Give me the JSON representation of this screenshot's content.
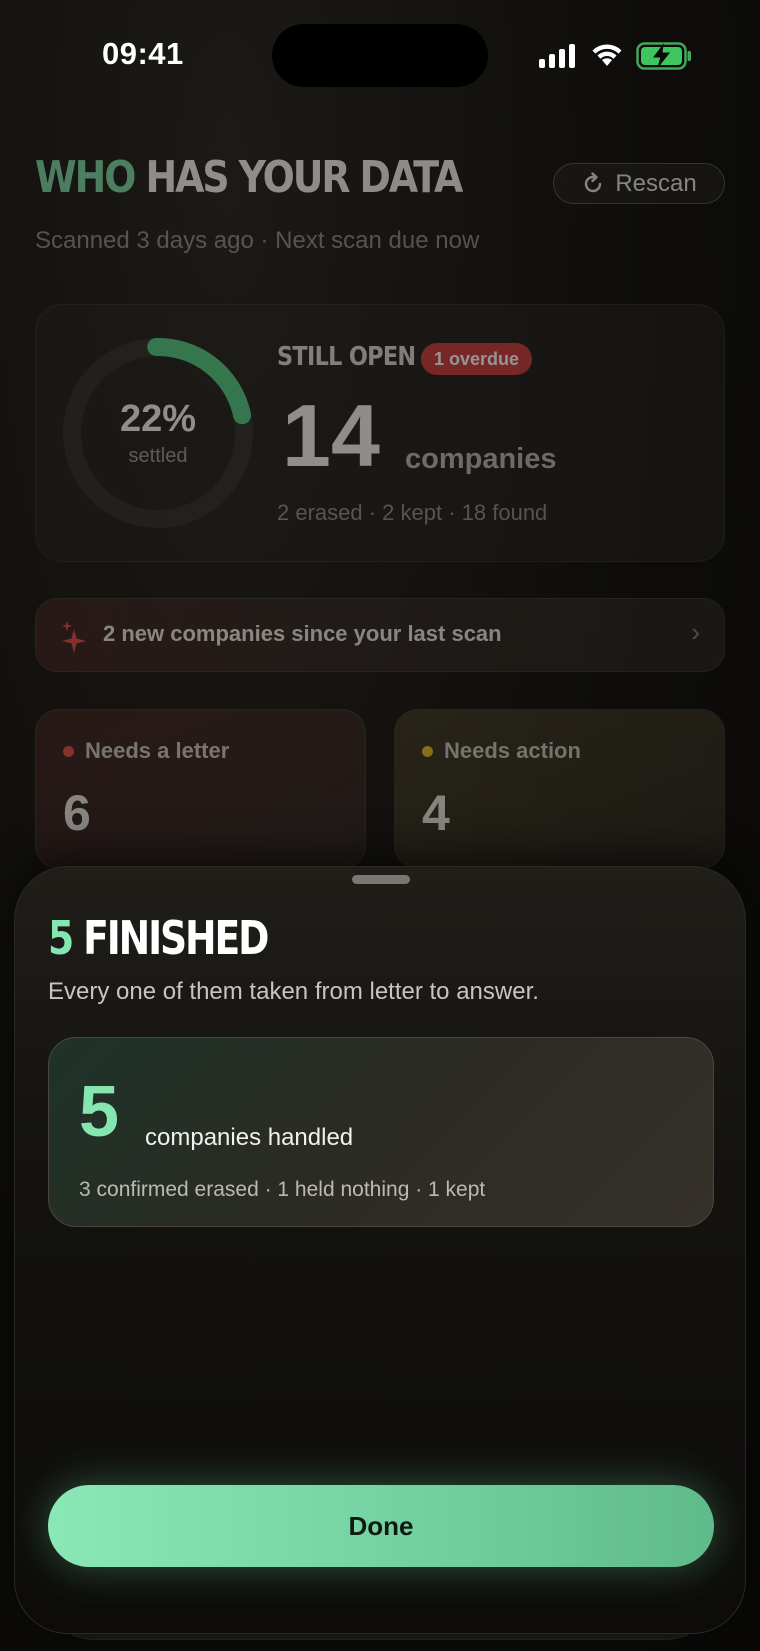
{
  "status_bar": {
    "time": "09:41"
  },
  "header": {
    "title_highlight": "WHO",
    "title_rest": "HAS YOUR DATA",
    "subtitle": "Scanned 3 days ago · Next scan due now",
    "rescan_label": "Rescan"
  },
  "summary": {
    "settled_percent": "22%",
    "settled_fraction": 0.22,
    "settled_label": "settled",
    "heading": "STILL OPEN",
    "overdue_badge": "1 overdue",
    "open_count": "14",
    "open_unit": "companies",
    "breakdown": "2 erased · 2 kept · 18 found"
  },
  "banner": {
    "text": "2 new companies since your last scan"
  },
  "tiles": [
    {
      "label": "Needs a letter",
      "count": "6",
      "color": "#e24b45"
    },
    {
      "label": "Needs action",
      "count": "4",
      "color": "#e6b830"
    }
  ],
  "sheet": {
    "title_count": "5",
    "title_text": "FINISHED",
    "subtitle": "Every one of them taken from letter to answer.",
    "card": {
      "count": "5",
      "label": "companies handled",
      "detail": "3 confirmed erased · 1 held nothing · 1 kept"
    },
    "done_label": "Done"
  },
  "colors": {
    "accent_green": "#86e6b2",
    "overdue_red": "#c9393a"
  },
  "icons": [
    "signal-icon",
    "wifi-icon",
    "battery-charging-icon",
    "refresh-icon",
    "sparkle-icon",
    "chevron-right-icon"
  ]
}
